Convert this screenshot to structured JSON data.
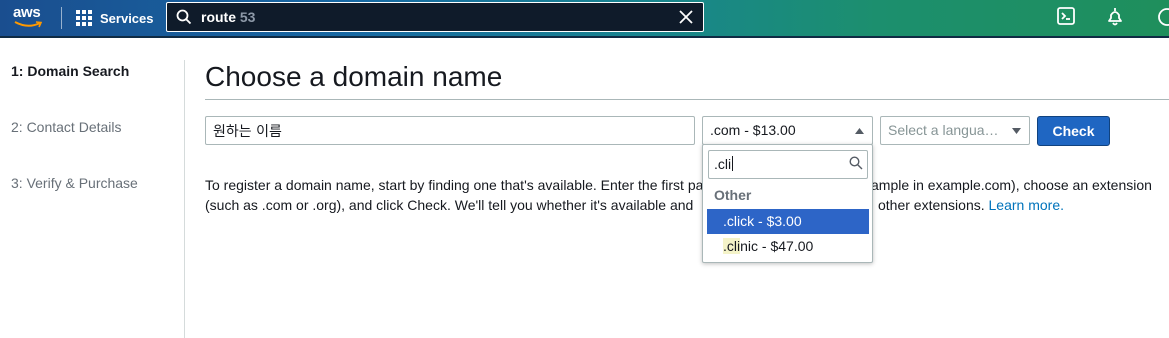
{
  "header": {
    "logo_text": "aws",
    "services_label": "Services",
    "search": {
      "query_typed": "route",
      "query_suggest": " 53"
    }
  },
  "sidebar": {
    "steps": [
      {
        "label": "1: Domain Search",
        "active": true
      },
      {
        "label": "2: Contact Details",
        "active": false
      },
      {
        "label": "3: Verify & Purchase",
        "active": false
      }
    ]
  },
  "main": {
    "title": "Choose a domain name",
    "domain_input_value": "원하는 이름",
    "extension_select_value": ".com - $13.00",
    "language_select_placeholder": "Select a langua…",
    "check_label": "Check",
    "description": {
      "line1_a": "To register a domain name, start by finding one that's available. Enter the first pa",
      "line1_b": "ample in example.com), choose an extension",
      "line2_a": "(such as .com or .org), and click Check. We'll tell you whether it's available and",
      "line2_b": "other extensions.",
      "learn_more": "Learn more."
    }
  },
  "dropdown": {
    "filter_value": ".cli",
    "group_label": "Other",
    "options": [
      {
        "label": ".click - $3.00",
        "prefix": ".cli",
        "rest": "ck - $3.00",
        "selected": true
      },
      {
        "label": ".clinic - $47.00",
        "prefix": ".cli",
        "rest": "nic - $47.00",
        "selected": false
      }
    ]
  },
  "colors": {
    "primary_button": "#1f66c2",
    "link": "#0073bb",
    "selected_option": "#2d65c7"
  }
}
